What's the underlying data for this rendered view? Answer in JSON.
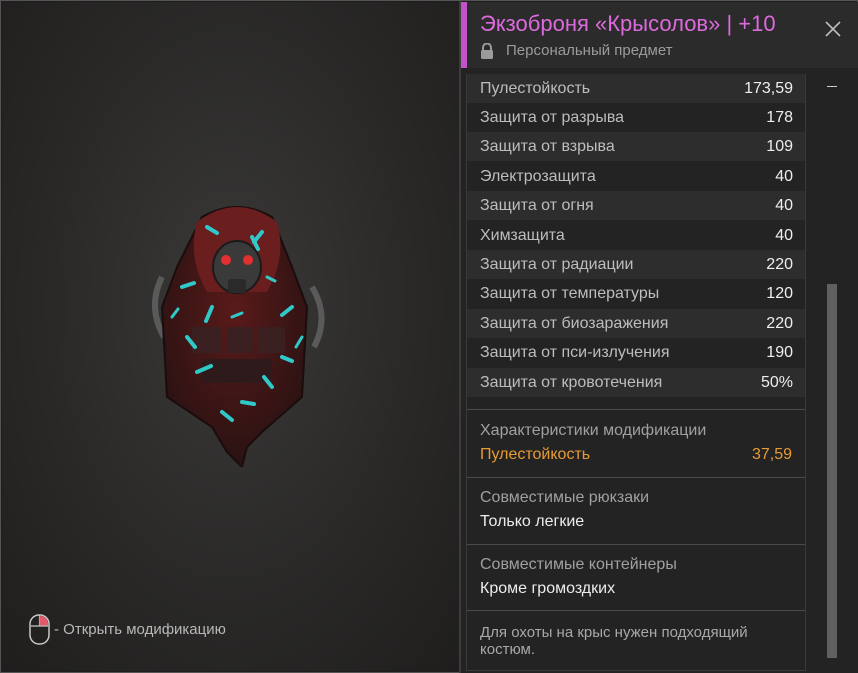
{
  "hint": {
    "text": "- Открыть модификацию"
  },
  "item": {
    "title": "Экзоброня «Крысолов» | +10",
    "subtitle": "Персональный предмет"
  },
  "stats": [
    {
      "label": "Пулестойкость",
      "value": "173,59"
    },
    {
      "label": "Защита от разрыва",
      "value": "178"
    },
    {
      "label": "Защита от взрыва",
      "value": "109"
    },
    {
      "label": "Электрозащита",
      "value": "40"
    },
    {
      "label": "Защита от огня",
      "value": "40"
    },
    {
      "label": "Химзащита",
      "value": "40"
    },
    {
      "label": "Защита от радиации",
      "value": "220"
    },
    {
      "label": "Защита от температуры",
      "value": "120"
    },
    {
      "label": "Защита от биозаражения",
      "value": "220"
    },
    {
      "label": "Защита от пси-излучения",
      "value": "190"
    },
    {
      "label": "Защита от кровотечения",
      "value": "50%"
    }
  ],
  "modification": {
    "header": "Характеристики модификации",
    "stat_label": "Пулестойкость",
    "stat_value": "37,59"
  },
  "backpacks": {
    "label": "Совместимые рюкзаки",
    "value": "Только легкие"
  },
  "containers": {
    "label": "Совместимые контейнеры",
    "value": "Кроме громоздких"
  },
  "description": "Для охоты на крыс нужен подходящий костюм.",
  "colors": {
    "title_accent": "#dc6ade",
    "modification_value": "#e79b35"
  },
  "icons": [
    "mouse-icon",
    "lock-icon",
    "close-icon"
  ]
}
